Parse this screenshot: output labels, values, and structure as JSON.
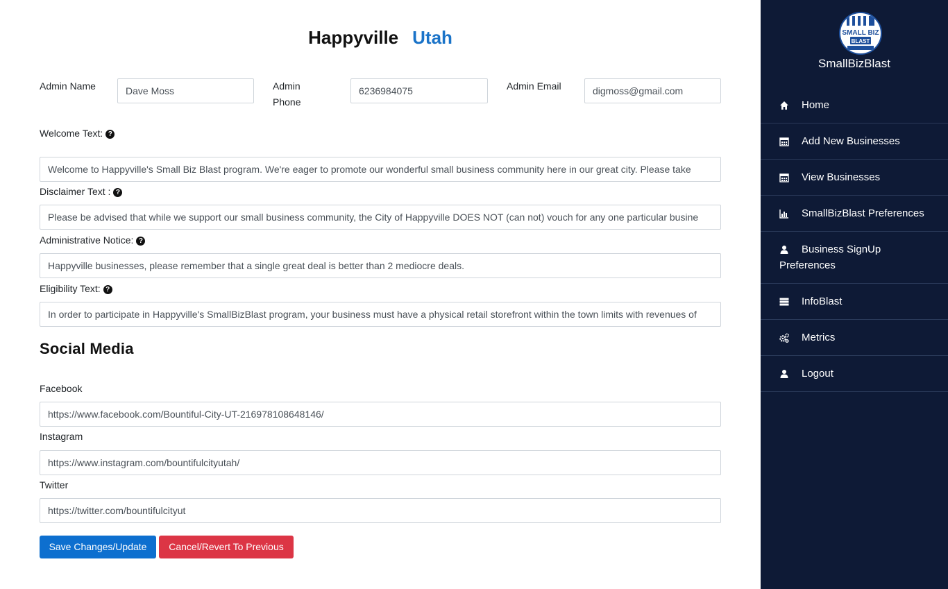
{
  "header": {
    "city": "Happyville",
    "state": "Utah"
  },
  "admin": {
    "name_label": "Admin Name",
    "name_value": "Dave Moss",
    "phone_label_1": "Admin",
    "phone_label_2": "Phone",
    "phone_value": "6236984075",
    "email_label": "Admin Email",
    "email_value": "digmoss@gmail.com"
  },
  "texts": {
    "welcome_label": "Welcome Text:",
    "welcome_value": "Welcome to Happyville's Small Biz Blast program.  We're eager to promote our wonderful small business community here in our great city.  Please take",
    "disclaimer_label": "Disclaimer Text :",
    "disclaimer_value": "Please be advised that while we support our small business community, the City of Happyville DOES NOT (can not) vouch for any one particular busine",
    "notice_label": "Administrative Notice:",
    "notice_value": "Happyville businesses, please remember that a single great deal is better than 2 mediocre deals.",
    "eligibility_label": "Eligibility Text:",
    "eligibility_value": "In order to participate in Happyville's SmallBizBlast program, your business must have a physical retail storefront within the town limits with revenues of"
  },
  "social": {
    "title": "Social Media",
    "facebook_label": "Facebook",
    "facebook_value": "https://www.facebook.com/Bountiful-City-UT-216978108648146/",
    "instagram_label": "Instagram",
    "instagram_value": "https://www.instagram.com/bountifulcityutah/",
    "twitter_label": "Twitter",
    "twitter_value": "https://twitter.com/bountifulcityut"
  },
  "actions": {
    "save_label": "Save Changes/Update",
    "cancel_label": "Cancel/Revert To Previous"
  },
  "sidebar": {
    "logo_line1": "SMALL BIZ",
    "logo_line2": "BLAST",
    "brand": "SmallBizBlast",
    "items": [
      {
        "label": "Home",
        "icon": "home-icon"
      },
      {
        "label": "Add New Businesses",
        "icon": "calendar-icon"
      },
      {
        "label": "View Businesses",
        "icon": "calendar-icon"
      },
      {
        "label": "SmallBizBlast Preferences",
        "icon": "bar-chart-icon"
      },
      {
        "label_line1": "Business SignUp",
        "label_line2": "Preferences",
        "icon": "user-icon"
      },
      {
        "label": "InfoBlast",
        "icon": "server-icon"
      },
      {
        "label": "Metrics",
        "icon": "gears-icon"
      },
      {
        "label": "Logout",
        "icon": "user-icon"
      }
    ]
  },
  "colors": {
    "sidebar_bg": "#0e1a36",
    "accent_blue": "#1a73c8",
    "save_button": "#0d6fcf",
    "cancel_button": "#dc3545"
  }
}
